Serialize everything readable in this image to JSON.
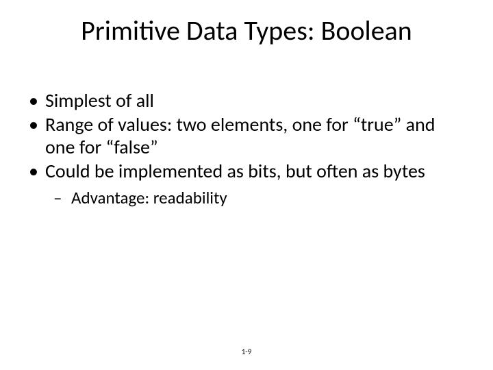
{
  "title": "Primitive Data Types: Boolean",
  "bullets": {
    "b0": "Simplest of all",
    "b1": "Range of values: two elements, one for “true” and one for “false”",
    "b2": "Could be implemented as bits, but often as bytes",
    "sub0": "Advantage: readability"
  },
  "footer": "1-9"
}
